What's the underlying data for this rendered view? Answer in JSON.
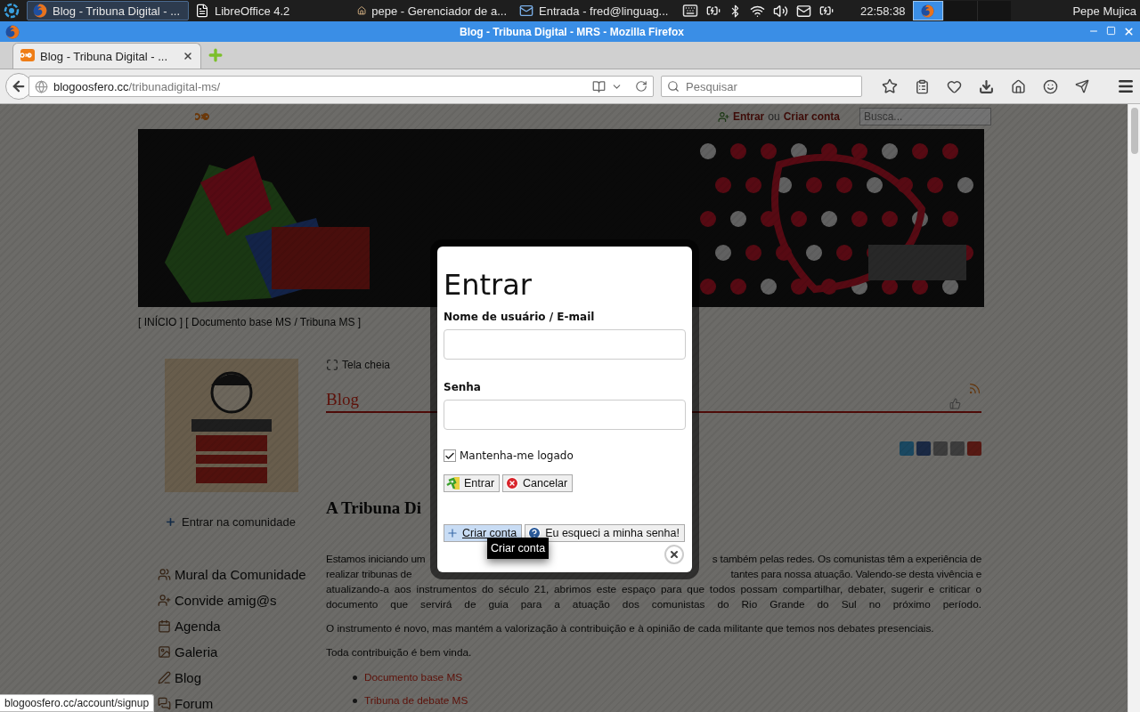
{
  "taskbar": {
    "tasks": [
      {
        "label": "Blog - Tribuna Digital - ...",
        "kind": "browser",
        "selected": true
      },
      {
        "label": "LibreOffice 4.2",
        "kind": "document",
        "selected": false
      },
      {
        "label": "pepe - Gerenciador de a...",
        "kind": "folder",
        "selected": false
      },
      {
        "label": "Entrada - fred@linguag...",
        "kind": "mail",
        "selected": false
      }
    ],
    "clock": "22:58:38",
    "user": "Pepe Mujica"
  },
  "window": {
    "title": "Blog - Tribuna Digital - MRS - Mozilla Firefox"
  },
  "tabs": [
    {
      "label": "Blog - Tribuna Digital - ...",
      "selected": true
    }
  ],
  "address": {
    "host": "blogoosfero.cc",
    "path": "/tribunadigital-ms/"
  },
  "search": {
    "placeholder": "Pesquisar"
  },
  "page": {
    "user_links": {
      "login": "Entrar",
      "or": "ou",
      "signup": "Criar conta"
    },
    "search": {
      "placeholder": "Busca..."
    },
    "breadcrumb": "[ INÍCIO ] [ Documento base MS / Tribuna MS ]",
    "toolbar": [
      "Tela cheia"
    ],
    "blog_title": "Blog",
    "join_link": "Entrar na comunidade",
    "menu": [
      {
        "label": "Mural da Comunidade"
      },
      {
        "label": "Convide amig@s"
      },
      {
        "label": "Agenda"
      },
      {
        "label": "Galeria"
      },
      {
        "label": "Blog"
      },
      {
        "label": "Forum"
      }
    ],
    "article": {
      "title": "A Tribuna Di",
      "paragraphs": [
        {
          "lines": [
            {
              "left": "Estamos iniciando um",
              "right": "s também pelas redes. Os comunistas têm a experiência de"
            },
            {
              "left": "realizar tribunas de",
              "right": "tantes para nossa atuação. Valendo-se desta vivência e"
            },
            {
              "text": "atualizando-a aos instrumentos do século 21, abrimos este espaço para que todos possam compartilhar, debater, sugerir e criticar o"
            },
            {
              "text": "documento que servirá de guia para a atuação dos comunistas do Rio Grande do Sul no próximo período."
            }
          ]
        },
        {
          "text": "O instrumento é novo, mas mantém a valorização à contribuição e à opinião de cada militante que temos nos debates presenciais."
        },
        {
          "text": "Toda contribuição é bem vinda."
        }
      ],
      "links": [
        "Documento base MS",
        "Tribuna de debate MS"
      ]
    }
  },
  "dialog": {
    "title": "Entrar",
    "fields": [
      {
        "label": "Nome de usuário / E-mail"
      },
      {
        "label": "Senha"
      }
    ],
    "remember": {
      "label": "Mantenha-me logado",
      "checked": true
    },
    "actions": [
      {
        "label": "Entrar",
        "kind": "enter"
      },
      {
        "label": "Cancelar",
        "kind": "cancel"
      }
    ],
    "links": [
      {
        "label": "Criar conta",
        "kind": "signup",
        "highlighted": true
      },
      {
        "label": "Eu esqueci a minha senha!",
        "kind": "forgot",
        "highlighted": false
      }
    ]
  },
  "tooltip": "Criar conta",
  "status_bar": "blogoosfero.cc/account/signup"
}
